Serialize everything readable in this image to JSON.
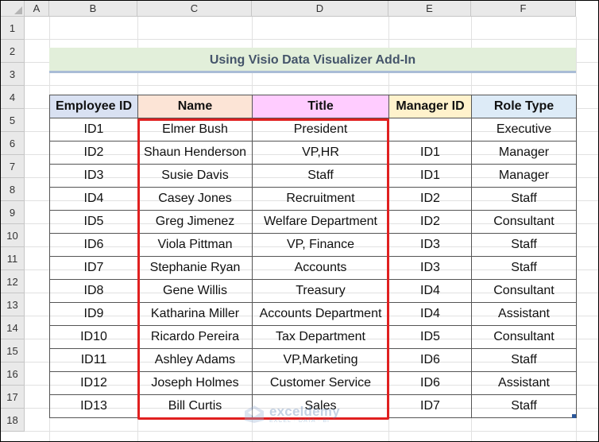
{
  "columns": [
    "A",
    "B",
    "C",
    "D",
    "E",
    "F"
  ],
  "rows": [
    "1",
    "2",
    "3",
    "4",
    "5",
    "6",
    "7",
    "8",
    "9",
    "10",
    "11",
    "12",
    "13",
    "14",
    "15",
    "16",
    "17",
    "18"
  ],
  "title": "Using Visio Data Visualizer Add-In",
  "headers": [
    "Employee ID",
    "Name",
    "Title",
    "Manager ID",
    "Role Type"
  ],
  "header_colors": [
    "#d9e1f2",
    "#fce4d6",
    "#ffccff",
    "#fff2cc",
    "#ddebf7"
  ],
  "records": [
    [
      "ID1",
      "Elmer Bush",
      "President",
      "",
      "Executive"
    ],
    [
      "ID2",
      "Shaun Henderson",
      "VP,HR",
      "ID1",
      "Manager"
    ],
    [
      "ID3",
      "Susie Davis",
      "Staff",
      "ID1",
      "Manager"
    ],
    [
      "ID4",
      "Casey Jones",
      "Recruitment",
      "ID2",
      "Staff"
    ],
    [
      "ID5",
      "Greg Jimenez",
      "Welfare Department",
      "ID2",
      "Consultant"
    ],
    [
      "ID6",
      "Viola Pittman",
      "VP, Finance",
      "ID3",
      "Staff"
    ],
    [
      "ID7",
      "Stephanie Ryan",
      "Accounts",
      "ID3",
      "Staff"
    ],
    [
      "ID8",
      "Gene Willis",
      "Treasury",
      "ID4",
      "Consultant"
    ],
    [
      "ID9",
      "Katharina Miller",
      "Accounts Department",
      "ID4",
      "Assistant"
    ],
    [
      "ID10",
      "Ricardo Pereira",
      "Tax Department",
      "ID5",
      "Consultant"
    ],
    [
      "ID11",
      "Ashley Adams",
      "VP,Marketing",
      "ID6",
      "Staff"
    ],
    [
      "ID12",
      "Joseph Holmes",
      "Customer Service",
      "ID6",
      "Assistant"
    ],
    [
      "ID13",
      "Bill Curtis",
      "Sales",
      "ID7",
      "Staff"
    ]
  ],
  "watermark": {
    "name": "exceldemy",
    "tagline": "EXCEL · DATA · BI"
  },
  "highlight_color": "#e02020"
}
